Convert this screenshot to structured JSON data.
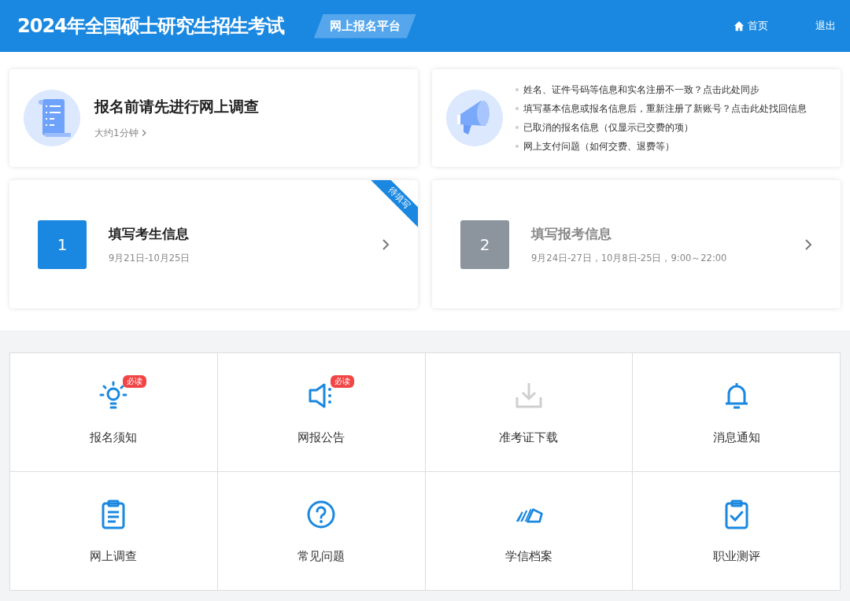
{
  "header": {
    "title": "2024年全国硕士研究生招生考试",
    "platform": "网上报名平台",
    "nav": [
      "首页",
      "退出"
    ]
  },
  "survey": {
    "title": "报名前请先进行网上调查",
    "subtitle": "大约1分钟"
  },
  "help_links": [
    "姓名、证件号码等信息和实名注册不一致？点击此处同步",
    "填写基本信息或报名信息后，重新注册了新账号？点击此处找回信息",
    "已取消的报名信息（仅显示已交费的项）",
    "网上支付问题（如何交费、退费等）"
  ],
  "steps": [
    {
      "number": "1",
      "title": "填写考生信息",
      "dates": "9月21日-10月25日",
      "disabled": false,
      "ribbon": "待填写"
    },
    {
      "number": "2",
      "title": "填写报考信息",
      "dates": "9月24日-27日，10月8日-25日，9:00～22:00",
      "disabled": true
    }
  ],
  "tiles": [
    {
      "label": "报名须知",
      "badge": "必读",
      "disabled": false
    },
    {
      "label": "网报公告",
      "badge": "必读",
      "disabled": false
    },
    {
      "label": "准考证下载",
      "disabled": true
    },
    {
      "label": "消息通知",
      "disabled": false
    },
    {
      "label": "网上调查",
      "disabled": false
    },
    {
      "label": "常见问题",
      "disabled": false
    },
    {
      "label": "学信档案",
      "disabled": false
    },
    {
      "label": "职业测评",
      "disabled": false
    }
  ]
}
